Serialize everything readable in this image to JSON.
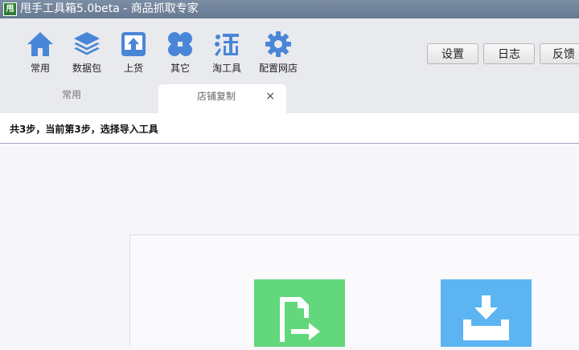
{
  "window": {
    "title": "甩手工具箱5.0beta - 商品抓取专家",
    "logo_char": "甩"
  },
  "toolbar": {
    "items": [
      {
        "label": "常用",
        "icon": "home-icon"
      },
      {
        "label": "数据包",
        "icon": "layers-icon"
      },
      {
        "label": "上货",
        "icon": "upload-icon"
      },
      {
        "label": "其它",
        "icon": "grid-icon"
      },
      {
        "label": "淘工具",
        "icon": "tao-icon"
      },
      {
        "label": "配置网店",
        "icon": "gear-icon"
      }
    ],
    "right_buttons": [
      {
        "label": "设置"
      },
      {
        "label": "日志"
      },
      {
        "label": "反馈"
      }
    ]
  },
  "tabs": [
    {
      "label": "常用",
      "active": false
    },
    {
      "label": "店铺复制",
      "active": true,
      "close": "×"
    }
  ],
  "step": {
    "text": "共3步，当前第3步，选择导入工具"
  },
  "colors": {
    "icon_blue": "#4a86d8",
    "card_green": "#62d77c",
    "card_blue": "#5cb4f2"
  }
}
